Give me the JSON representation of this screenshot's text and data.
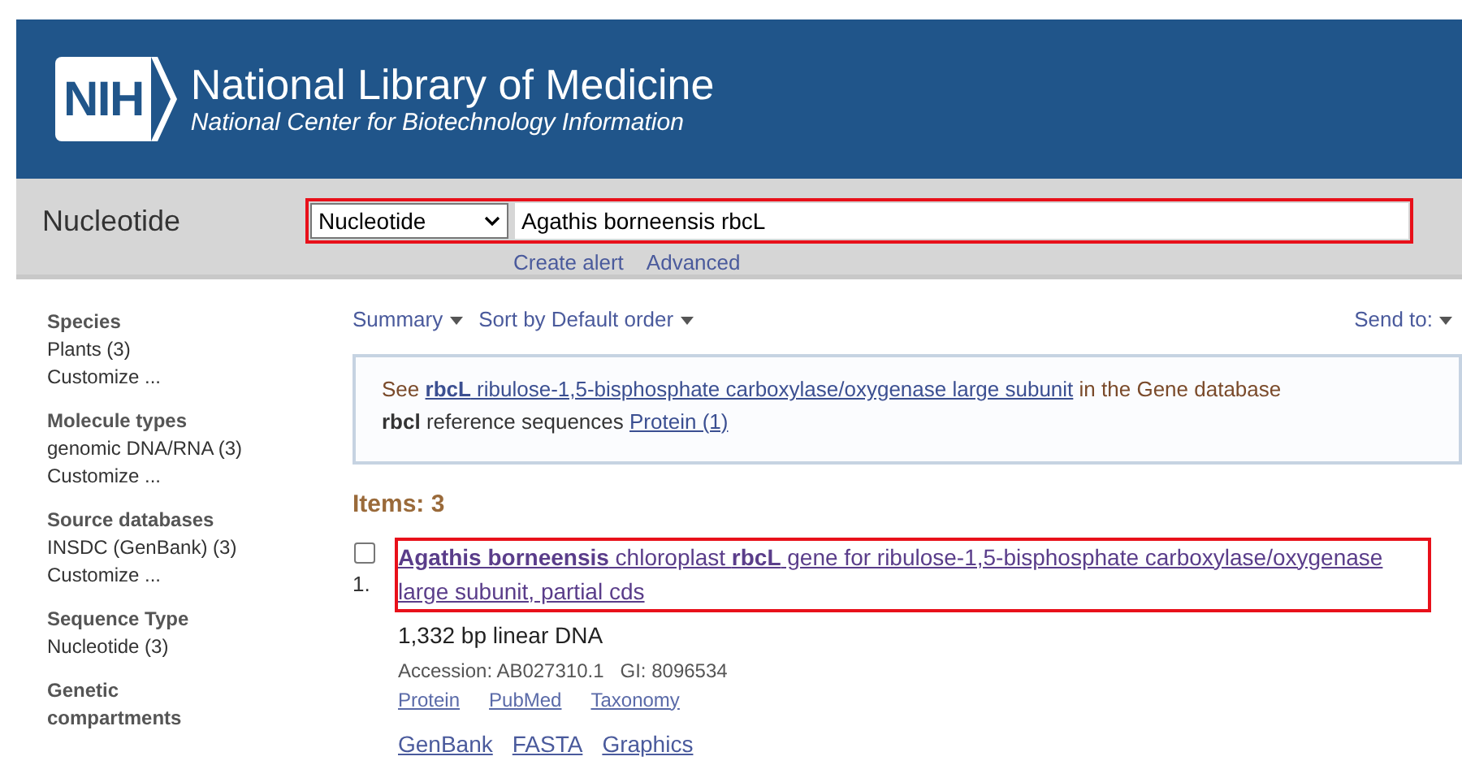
{
  "header": {
    "logo": "NIH",
    "title": "National Library of Medicine",
    "subtitle": "National Center for Biotechnology Information"
  },
  "search": {
    "database_label": "Nucleotide",
    "select_value": "Nucleotide",
    "query": "Agathis borneensis rbcL",
    "links": [
      "Create alert",
      "Advanced"
    ]
  },
  "sidebar": {
    "sections": [
      {
        "title": "Species",
        "items": [
          "Plants (3)",
          "Customize ..."
        ]
      },
      {
        "title": "Molecule types",
        "items": [
          "genomic DNA/RNA (3)",
          "Customize ..."
        ]
      },
      {
        "title": "Source databases",
        "items": [
          "INSDC (GenBank) (3)",
          "Customize ..."
        ]
      },
      {
        "title": "Sequence Type",
        "items": [
          "Nucleotide (3)"
        ]
      },
      {
        "title": "Genetic compartments"
      }
    ]
  },
  "toolbar": {
    "format": "Summary",
    "sort": "Sort by Default order",
    "send": "Send to:"
  },
  "gene_box": {
    "line1_prefix": "See",
    "line1_link": "**rbcL** ribulose-1,5-bisphosphate carboxylase/oxygenase large subunit",
    "line1_suffix": "in the Gene database",
    "line2_bold": "rbcl",
    "line2_text": "reference sequences",
    "line2_link": "Protein (1)"
  },
  "items_count": "Items: 3",
  "results": [
    {
      "number": "1.",
      "checked": false,
      "title": "**Agathis borneensis** chloroplast **rbcL** gene for ribulose-1,5-bisphosphate carboxylase/oxygenase large subunit, partial cds",
      "description": "1,332 bp linear DNA",
      "accession": "Accession: AB027310.1   GI: 8096534",
      "related_links": [
        "Protein",
        "PubMed",
        "Taxonomy"
      ],
      "format_links": [
        "GenBank",
        "FASTA",
        "Graphics"
      ]
    }
  ]
}
